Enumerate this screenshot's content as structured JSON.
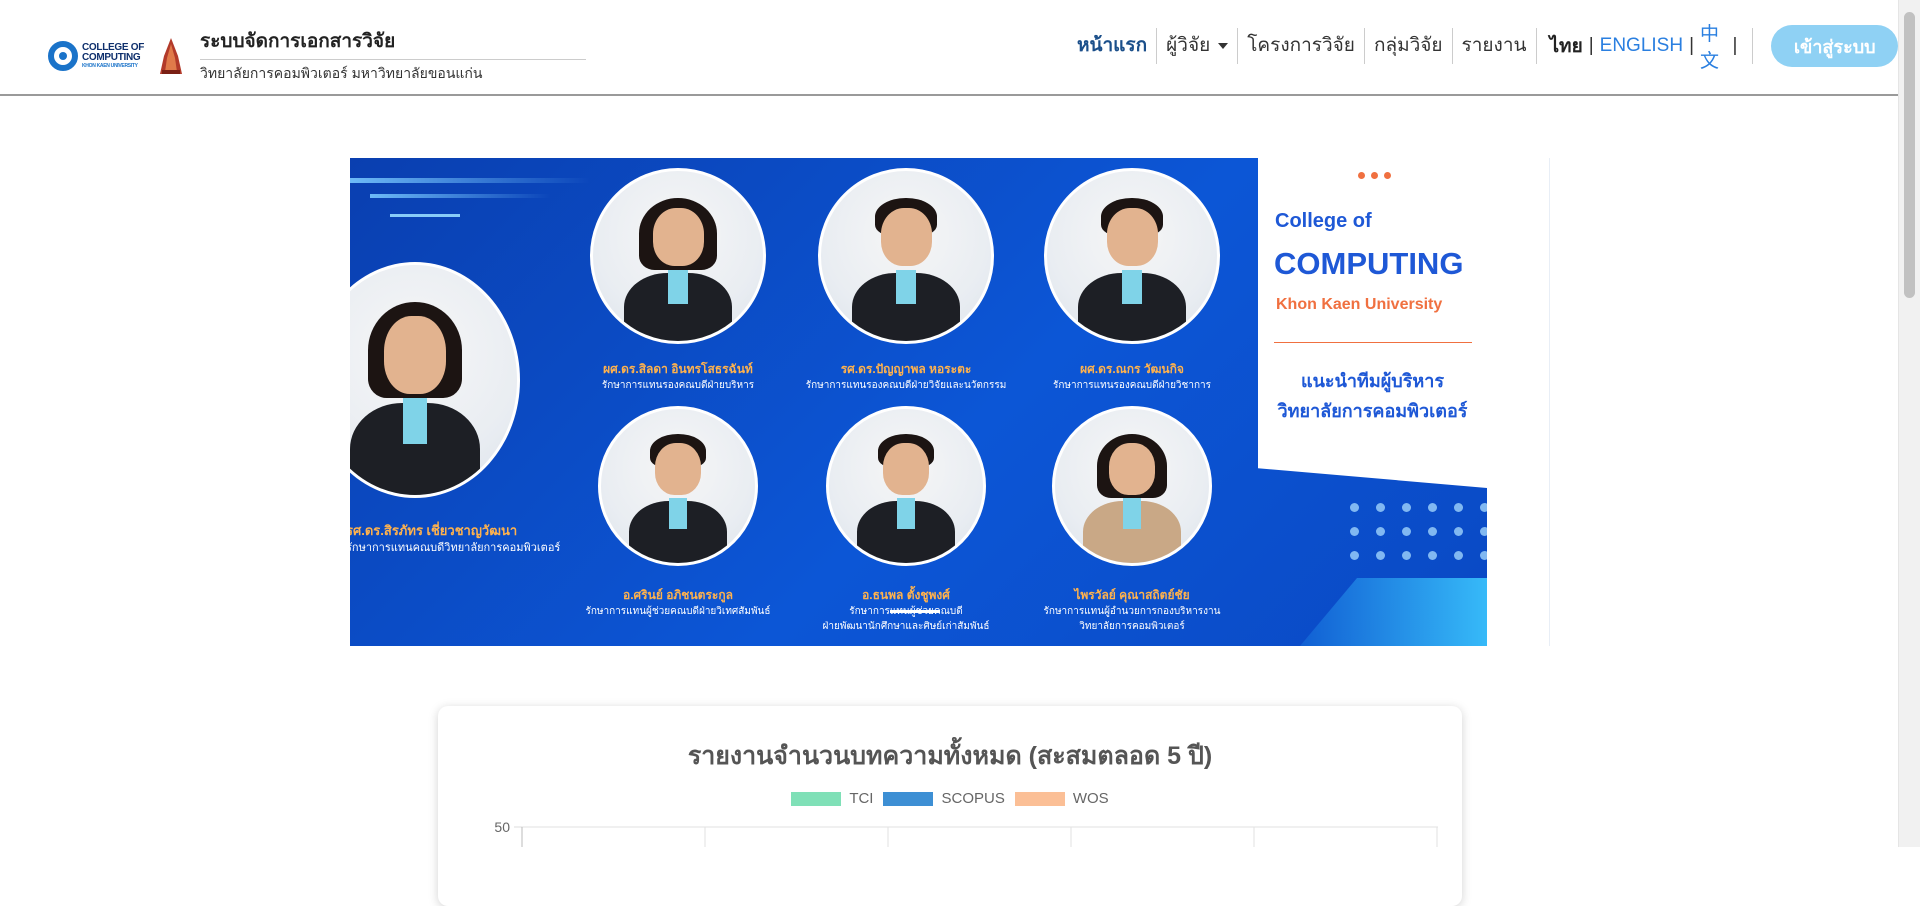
{
  "header": {
    "logo_text_line1": "COLLEGE OF",
    "logo_text_line2": "COMPUTING",
    "logo_text_small": "KHON KAEN UNIVERSITY",
    "title": "ระบบจัดการเอกสารวิจัย",
    "subtitle": "วิทยาลัยการคอมพิวเตอร์ มหาวิทยาลัยขอนแก่น"
  },
  "nav": {
    "home": "หน้าแรก",
    "researcher": "ผู้วิจัย",
    "projects": "โครงการวิจัย",
    "groups": "กลุ่มวิจัย",
    "reports": "รายงาน"
  },
  "languages": {
    "thai": "ไทย",
    "english": "ENGLISH",
    "chinese": "中文",
    "separator": "|"
  },
  "login_button": "เข้าสู่ระบบ",
  "banner": {
    "college_of": "College of",
    "computing": "COMPUTING",
    "university": "Khon Kaen University",
    "intro_line1": "แนะนำทีมผู้บริหาร",
    "intro_line2": "วิทยาลัยการคอมพิวเตอร์",
    "people": [
      {
        "name": "รศ.ดร.สิรภัทร เชี่ยวชาญวัฒนา",
        "role": "รักษาการแทนคณบดีวิทยาลัยการคอมพิวเตอร์",
        "role2": ""
      },
      {
        "name": "ผศ.ดร.สิลดา อินทรโสธรฉันท์",
        "role": "รักษาการแทนรองคณบดีฝ่ายบริหาร",
        "role2": ""
      },
      {
        "name": "รศ.ดร.ปัญญาพล หอระตะ",
        "role": "รักษาการแทนรองคณบดีฝ่ายวิจัยและนวัตกรรม",
        "role2": ""
      },
      {
        "name": "ผศ.ดร.ณกร วัฒนกิจ",
        "role": "รักษาการแทนรองคณบดีฝ่ายวิชาการ",
        "role2": ""
      },
      {
        "name": "อ.ศรินย์ อภิชนตระกูล",
        "role": "รักษาการแทนผู้ช่วยคณบดีฝ่ายวิเทศสัมพันธ์",
        "role2": ""
      },
      {
        "name": "อ.ธนพล ตั้งชูพงศ์",
        "role": "รักษาการแทนผู้ช่วยคณบดี",
        "role2": "ฝ่ายพัฒนานักศึกษาและศิษย์เก่าสัมพันธ์"
      },
      {
        "name": "ไพรวัลย์ คุณาสถิตย์ชัย",
        "role": "รักษาการแทนผู้อำนวยการกองบริหารงาน",
        "role2": "วิทยาลัยการคอมพิวเตอร์"
      }
    ]
  },
  "chart_data": {
    "type": "bar",
    "title": "รายงานจำนวนบทความทั้งหมด (สะสมตลอด 5 ปี)",
    "legend_position": "top",
    "series": [
      {
        "name": "TCI",
        "color": "#7fe0b7"
      },
      {
        "name": "SCOPUS",
        "color": "#3d8fd4"
      },
      {
        "name": "WOS",
        "color": "#fbbf96"
      }
    ],
    "y_ticks_visible": [
      "50"
    ],
    "ylim_top": 50,
    "grid": true
  }
}
